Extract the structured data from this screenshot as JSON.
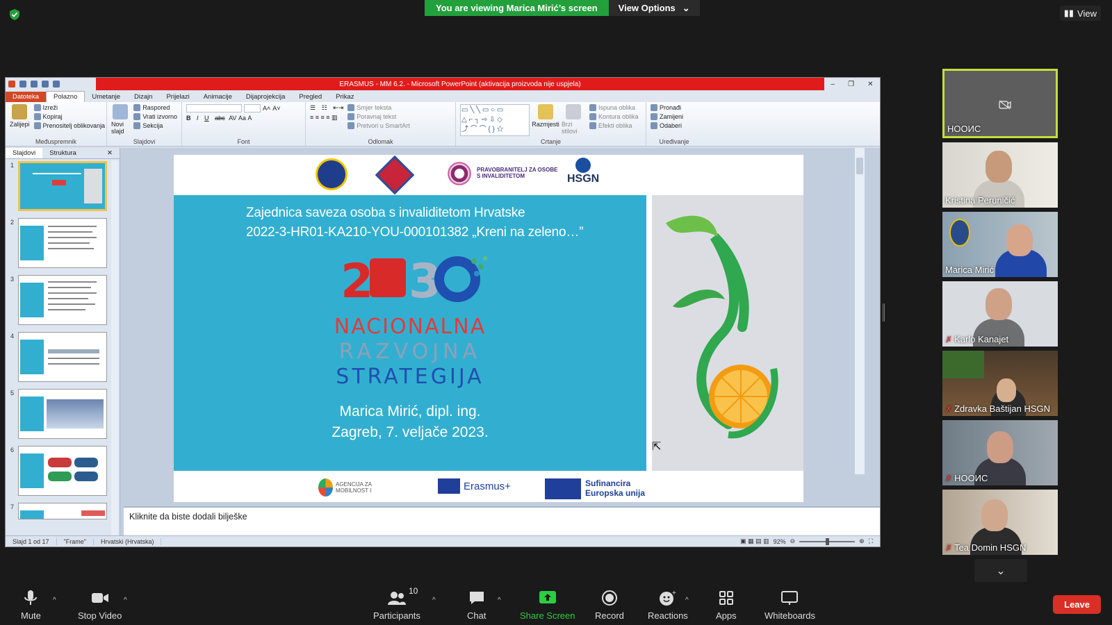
{
  "banner": {
    "viewing": "You are viewing Marica Mirić’s screen",
    "view_options": "View Options"
  },
  "top_right": {
    "view": "View"
  },
  "ppt": {
    "window_title": "ERASMUS - MM 6.2. - Microsoft PowerPoint (aktivacija proizvoda nije uspjela)",
    "tabs": [
      "Datoteka",
      "Polazno",
      "Umetanje",
      "Dizajn",
      "Prijelazi",
      "Animacije",
      "Dijaprojekcija",
      "Pregled",
      "Prikaz"
    ],
    "ribbon": {
      "clipboard": {
        "paste": "Zalijepi",
        "cut": "Izreži",
        "copy": "Kopiraj",
        "format_painter": "Prenositelj oblikovanja",
        "label": "Međuspremnik"
      },
      "slides": {
        "new": "Novi slajd",
        "layout": "Raspored",
        "reset": "Vrati izvorno",
        "section": "Sekcija",
        "label": "Slajdovi"
      },
      "font": {
        "label": "Font"
      },
      "paragraph": {
        "text_direction": "Smjer teksta",
        "align_text": "Poravnaj tekst",
        "smartart": "Pretvori u SmartArt",
        "label": "Odlomak"
      },
      "drawing": {
        "arrange": "Razmjesti",
        "quick_styles": "Brzi stilovi",
        "fill": "Ispuna oblika",
        "outline": "Kontura oblika",
        "effects": "Efekti oblika",
        "label": "Crtanje"
      },
      "editing": {
        "find": "Pronađi",
        "replace": "Zamijeni",
        "select": "Odaberi",
        "label": "Uređivanje"
      }
    },
    "panel_tabs": {
      "slides": "Slajdovi",
      "outline": "Struktura"
    },
    "thumbs": [
      "1",
      "2",
      "3",
      "4",
      "5",
      "6",
      "7"
    ],
    "slide": {
      "prav_logo_text": "PRAVOBRANITELJ ZA OSOBE S INVALIDITETOM",
      "hsgn": "HSGN",
      "line1": "Zajednica saveza osoba s invaliditetom Hrvatske",
      "line2": "2022-3-HR01-KA210-YOU-000101382 „Kreni na zeleno…”",
      "nrs1": "NACIONALNA",
      "nrs2": "RAZVOJNA",
      "nrs3": "STRATEGIJA",
      "author": "Marica Mirić, dipl. ing.",
      "place_date": "Zagreb, 7. veljače 2023.",
      "agency": "AGENCIJA ZA MOBILNOST I",
      "erasmus": "Erasmus+",
      "cofund1": "Sufinancira",
      "cofund2": "Europska unija"
    },
    "notes_placeholder": "Kliknite da biste dodali bilješke",
    "status": {
      "slide": "Slajd 1 od 17",
      "theme": "\"Frame\"",
      "lang": "Hrvatski (Hrvatska)",
      "zoom": "92%"
    }
  },
  "participants": [
    {
      "name": "НООИС",
      "video": false,
      "muted": false
    },
    {
      "name": "Kristina Peruničić",
      "video": true,
      "muted": false
    },
    {
      "name": "Marica Mirić",
      "video": true,
      "muted": false
    },
    {
      "name": "Karlo Kanajet",
      "video": true,
      "muted": true
    },
    {
      "name": "Zdravka Baštijan HSGN",
      "video": true,
      "muted": true
    },
    {
      "name": "НООИС",
      "video": true,
      "muted": true
    },
    {
      "name": "Tea Domin HSGN",
      "video": true,
      "muted": true
    }
  ],
  "controls": {
    "mute": "Mute",
    "stop_video": "Stop Video",
    "participants": "Participants",
    "participants_count": "10",
    "chat": "Chat",
    "share": "Share Screen",
    "record": "Record",
    "reactions": "Reactions",
    "apps": "Apps",
    "whiteboards": "Whiteboards",
    "leave": "Leave"
  }
}
